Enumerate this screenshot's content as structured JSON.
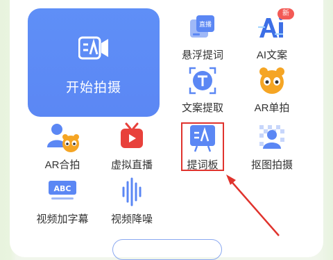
{
  "hero": {
    "label": "开始拍摄",
    "icon": "teleprompter-camera-icon"
  },
  "tools": [
    {
      "label": "悬浮提词",
      "icon": "floating-prompt-icon",
      "badge": ""
    },
    {
      "label": "AI文案",
      "icon": "ai-copywriting-icon",
      "badge": "新"
    },
    {
      "label": "文案提取",
      "icon": "text-extract-icon",
      "badge": ""
    },
    {
      "label": "AR单拍",
      "icon": "ar-single-shot-icon",
      "badge": ""
    },
    {
      "label": "AR合拍",
      "icon": "ar-duet-icon",
      "badge": ""
    },
    {
      "label": "虚拟直播",
      "icon": "virtual-live-icon",
      "badge": ""
    },
    {
      "label": "提词板",
      "icon": "teleprompter-board-icon",
      "badge": ""
    },
    {
      "label": "抠图拍摄",
      "icon": "cutout-shoot-icon",
      "badge": ""
    },
    {
      "label": "视频加字幕",
      "icon": "video-subtitle-icon",
      "badge": ""
    },
    {
      "label": "视频降噪",
      "icon": "video-denoise-icon",
      "badge": ""
    }
  ],
  "icon_texts": {
    "floating_prompt": "直播",
    "video_subtitle": "ABC"
  },
  "annotation": {
    "highlight_color": "#e0332d",
    "arrow_color": "#e0332d",
    "target": "提词板"
  },
  "colors": {
    "accent": "#5b87f4",
    "badge": "#f35a55",
    "ar_yellow": "#f5a524"
  }
}
